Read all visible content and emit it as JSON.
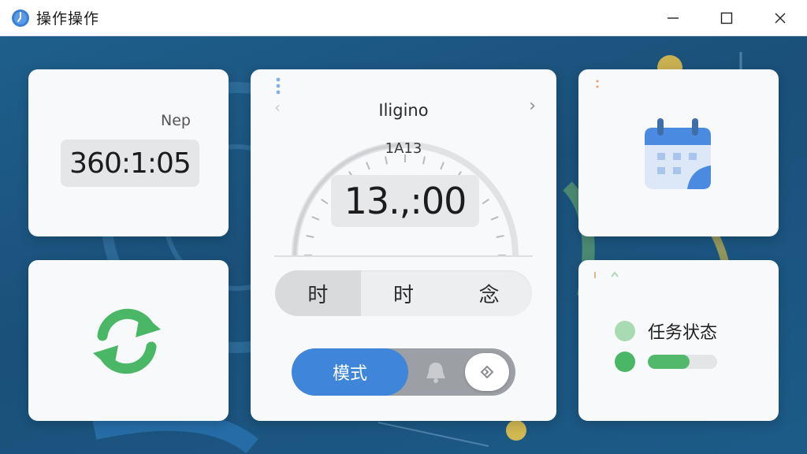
{
  "window": {
    "title": "操作操作",
    "icon": "clock-app-icon",
    "controls": [
      "minimize-icon",
      "maximize-icon",
      "close-icon"
    ]
  },
  "timer_card": {
    "label": "Nep",
    "time": "360:1:05"
  },
  "sync_card": {
    "icon": "sync-icon",
    "color": "#4ab766"
  },
  "clock_card": {
    "title": "Iligino",
    "subtitle": "1A13",
    "time": "13.,:00",
    "nav": {
      "prev": "‹",
      "next": "›"
    },
    "segments": [
      {
        "label": "时",
        "active": true
      },
      {
        "label": "时",
        "active": false
      },
      {
        "label": "念",
        "active": false
      }
    ],
    "mode_toggle": {
      "label": "模式",
      "accent": "#3f86db"
    }
  },
  "calendar_card": {
    "icon": "calendar-icon",
    "color": "#4a8ae0"
  },
  "status_card": {
    "label": "任务状态",
    "progress": 0.6,
    "colors": {
      "light": "#a8dbb1",
      "green": "#4ab766"
    }
  }
}
